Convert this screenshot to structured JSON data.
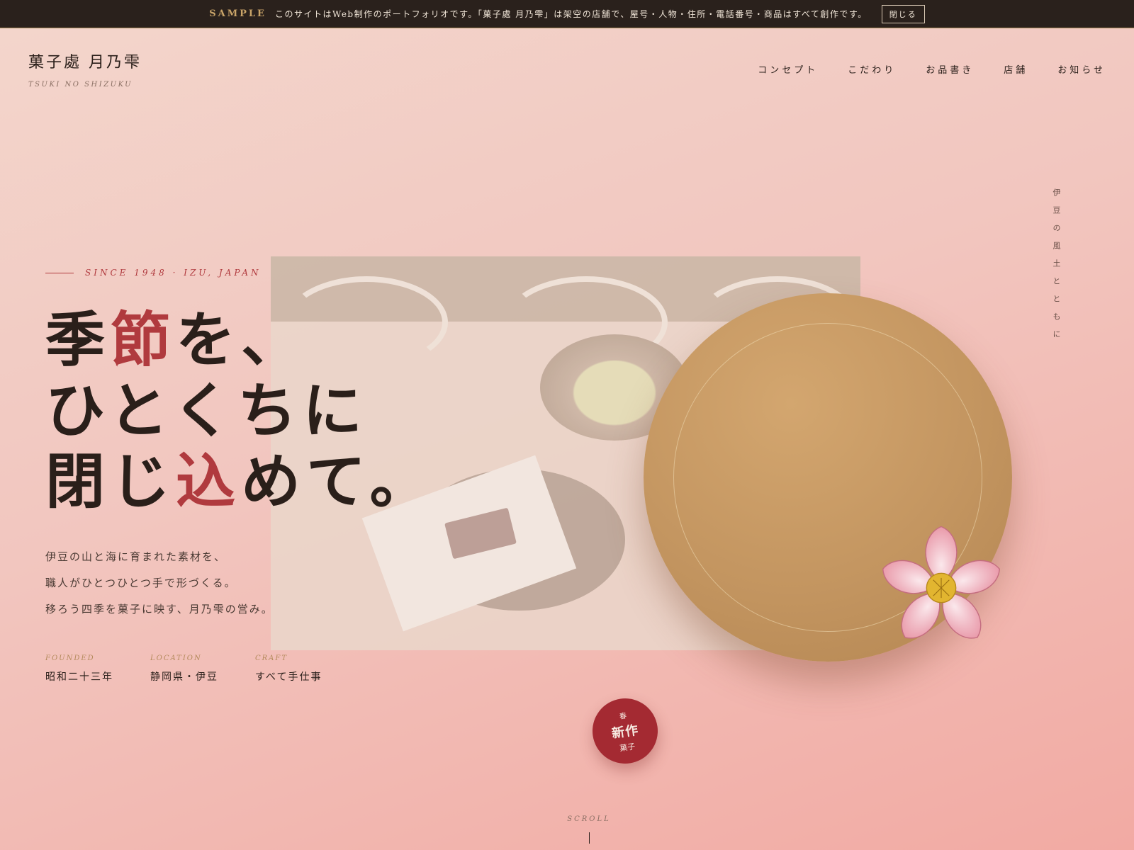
{
  "notice": {
    "tag": "SAMPLE",
    "text": "このサイトはWeb制作のポートフォリオです。「菓子處 月乃雫」は架空の店舗で、屋号・人物・住所・電話番号・商品はすべて創作です。",
    "close_label": "閉じる"
  },
  "brand": {
    "name_jp": "菓子處 月乃雫",
    "name_en": "TSUKI NO SHIZUKU"
  },
  "nav": {
    "items": [
      "コンセプト",
      "こだわり",
      "お品書き",
      "店舗",
      "お知らせ"
    ]
  },
  "vertical_text": "伊豆の風土とともに",
  "hero": {
    "since": "SINCE 1948 · IZU, JAPAN",
    "line1_pre": "季",
    "line1_accent": "節",
    "line1_post": "を、",
    "line2": "ひとくちに",
    "line3_pre": "閉じ",
    "line3_accent": "込",
    "line3_post": "めて。",
    "lead": [
      "伊豆の山と海に育まれた素材を、",
      "職人がひとつひとつ手で形づくる。",
      "移ろう四季を菓子に映す、月乃雫の営み。"
    ]
  },
  "facts": [
    {
      "label": "FOUNDED",
      "value": "昭和二十三年"
    },
    {
      "label": "LOCATION",
      "value": "静岡県・伊豆"
    },
    {
      "label": "CRAFT",
      "value": "すべて手仕事"
    }
  ],
  "badge": {
    "season": "春",
    "main": "新作",
    "sub": "菓子"
  },
  "scroll_label": "SCROLL",
  "colors": {
    "accent": "#b03a3e",
    "gold": "#c39560",
    "dark": "#2a211c"
  }
}
